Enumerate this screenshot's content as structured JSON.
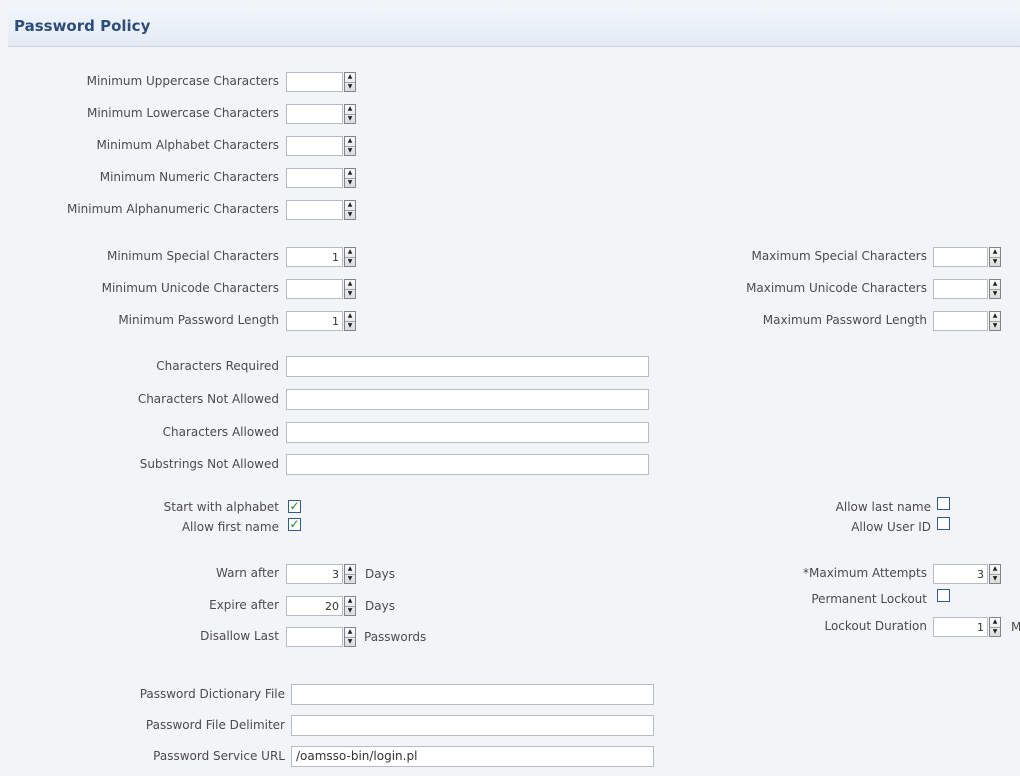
{
  "header": {
    "title": "Password Policy"
  },
  "fields": {
    "min_uppercase": {
      "label": "Minimum Uppercase Characters",
      "value": ""
    },
    "min_lowercase": {
      "label": "Minimum Lowercase Characters",
      "value": ""
    },
    "min_alphabet": {
      "label": "Minimum Alphabet Characters",
      "value": ""
    },
    "min_numeric": {
      "label": "Minimum Numeric Characters",
      "value": ""
    },
    "min_alphanumeric": {
      "label": "Minimum Alphanumeric Characters",
      "value": ""
    },
    "min_special": {
      "label": "Minimum Special Characters",
      "value": "1"
    },
    "min_unicode": {
      "label": "Minimum Unicode Characters",
      "value": ""
    },
    "min_length": {
      "label": "Minimum Password Length",
      "value": "1"
    },
    "max_special": {
      "label": "Maximum Special Characters",
      "value": ""
    },
    "max_unicode": {
      "label": "Maximum Unicode Characters",
      "value": ""
    },
    "max_length": {
      "label": "Maximum Password Length",
      "value": ""
    },
    "chars_required": {
      "label": "Characters Required",
      "value": ""
    },
    "chars_not_allowed": {
      "label": "Characters Not Allowed",
      "value": ""
    },
    "chars_allowed": {
      "label": "Characters Allowed",
      "value": ""
    },
    "substrings_not_allowed": {
      "label": "Substrings Not Allowed",
      "value": ""
    },
    "start_with_alphabet": {
      "label": "Start with alphabet",
      "checked": true
    },
    "allow_first_name": {
      "label": "Allow first name",
      "checked": true
    },
    "allow_last_name": {
      "label": "Allow last name",
      "checked": false
    },
    "allow_user_id": {
      "label": "Allow User ID",
      "checked": false
    },
    "warn_after": {
      "label": "Warn after",
      "value": "3",
      "unit": "Days"
    },
    "expire_after": {
      "label": "Expire after",
      "value": "20",
      "unit": "Days"
    },
    "disallow_last": {
      "label": "Disallow Last",
      "value": "",
      "unit": "Passwords"
    },
    "max_attempts": {
      "required_marker": "*",
      "label": "Maximum Attempts",
      "value": "3"
    },
    "permanent_lockout": {
      "label": "Permanent Lockout",
      "checked": false
    },
    "lockout_duration": {
      "label": "Lockout Duration",
      "value": "1",
      "unit": "M"
    },
    "dictionary_file": {
      "label": "Password Dictionary File",
      "value": ""
    },
    "file_delimiter": {
      "label": "Password File Delimiter",
      "value": ""
    },
    "service_url": {
      "label": "Password Service URL",
      "value": "/oamsso-bin/login.pl"
    }
  },
  "icons": {
    "spinner": "spinner-arrows-icon",
    "check": "checkmark-icon"
  },
  "colors": {
    "title": "#2d4e7a",
    "check": "#1a8a1a",
    "checkbox_border": "#2f5a8a"
  }
}
